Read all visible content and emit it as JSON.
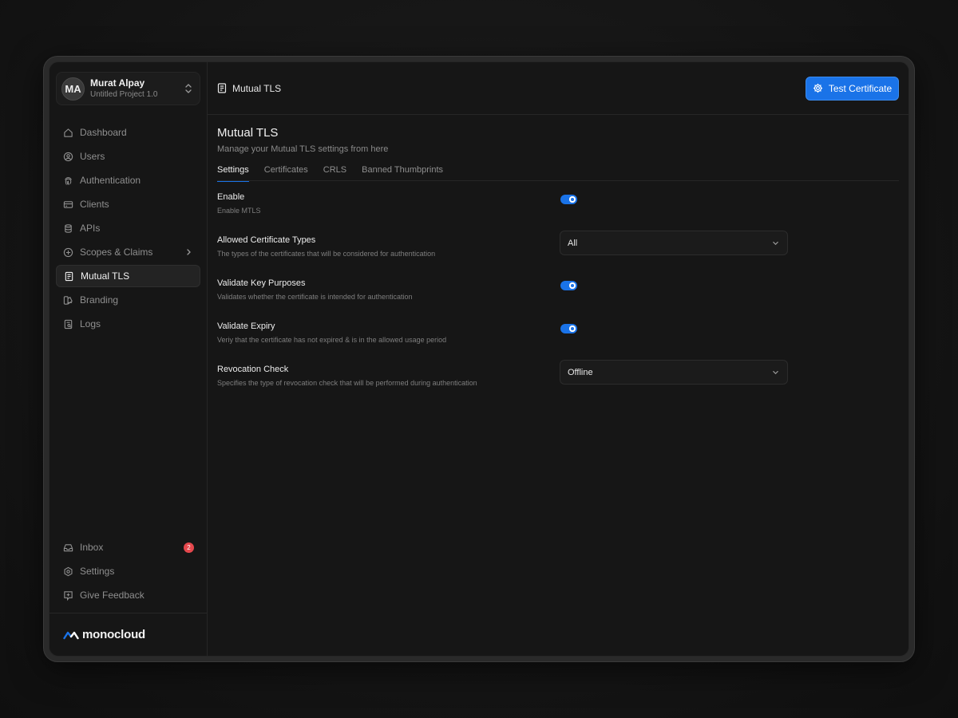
{
  "user": {
    "initials": "MA",
    "name": "Murat Alpay",
    "project": "Untitled Project 1.0"
  },
  "nav": {
    "dashboard": "Dashboard",
    "users": "Users",
    "authentication": "Authentication",
    "clients": "Clients",
    "apis": "APIs",
    "scopes": "Scopes & Claims",
    "mtls": "Mutual TLS",
    "branding": "Branding",
    "logs": "Logs"
  },
  "nav_bottom": {
    "inbox": "Inbox",
    "inbox_count": "2",
    "settings": "Settings",
    "feedback": "Give Feedback"
  },
  "brand": {
    "name": "monocloud",
    "accent": "#1a73e8"
  },
  "topbar": {
    "title": "Mutual TLS",
    "test_button": "Test Certificate"
  },
  "page": {
    "title": "Mutual TLS",
    "subtitle": "Manage your Mutual TLS settings from here"
  },
  "tabs": {
    "settings": "Settings",
    "certificates": "Certificates",
    "crls": "CRLS",
    "banned": "Banned Thumbprints"
  },
  "settings": {
    "enable": {
      "label": "Enable",
      "desc": "Enable MTLS",
      "on": true
    },
    "cert_types": {
      "label": "Allowed Certificate Types",
      "desc": "The types of the certificates that will be considered for authentication",
      "value": "All"
    },
    "key_purposes": {
      "label": "Validate Key Purposes",
      "desc": "Validates whether the certificate is intended for authentication",
      "on": true
    },
    "expiry": {
      "label": "Validate Expiry",
      "desc": "Veriy that the certificate has not expired & is in the allowed usage period",
      "on": true
    },
    "revocation": {
      "label": "Revocation Check",
      "desc": "Specifies the type of revocation check that will be performed during authentication",
      "value": "Offline"
    }
  }
}
